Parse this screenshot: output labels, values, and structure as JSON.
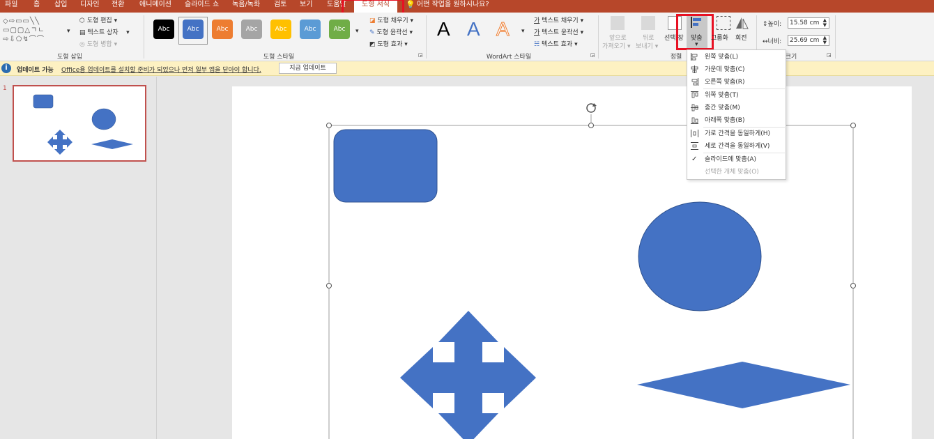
{
  "tabs": {
    "items": [
      "파일",
      "홈",
      "삽입",
      "디자인",
      "전환",
      "애니메이션",
      "슬라이드 쇼",
      "녹음/녹화",
      "검토",
      "보기",
      "도움말"
    ],
    "active": "도형 서식",
    "tell_me": "어떤 작업을 원하시나요?"
  },
  "ribbon": {
    "insert_shapes": {
      "label": "도형 삽입",
      "edit_shape": "도형 편집",
      "text_box": "텍스트 상자",
      "merge_shapes": "도형 병합"
    },
    "shape_styles": {
      "label": "도형 스타일",
      "swatch_text": "Abc",
      "swatch_colors": [
        "#000000",
        "#4472c4",
        "#ed7d31",
        "#a5a5a5",
        "#ffc000",
        "#5b9bd5",
        "#70ad47"
      ],
      "fill": "도형 채우기",
      "outline": "도형 윤곽선",
      "effects": "도형 효과"
    },
    "wordart": {
      "label": "WordArt 스타일",
      "text_fill": "텍스트 채우기",
      "text_outline": "텍스트 윤곽선",
      "text_effects": "텍스트 효과"
    },
    "arrange": {
      "label": "정렬",
      "bring_forward_1": "앞으로",
      "bring_forward_2": "가져오기",
      "send_backward_1": "뒤로",
      "send_backward_2": "보내기",
      "selection_pane": "선택 창",
      "align": "맞춤",
      "group": "그룹화",
      "rotate": "회전"
    },
    "size": {
      "label": "크기",
      "height_label": "높이:",
      "height_value": "15.58 cm",
      "width_label": "너비:",
      "width_value": "25.69 cm"
    }
  },
  "notice": {
    "title": "업데이트 가능",
    "message": "Office용 업데이트를 설치할 준비가 되었으나 먼저 일부 앱을 닫아야 합니다.",
    "button": "지금 업데이트"
  },
  "slides": {
    "number": "1"
  },
  "align_menu": {
    "items": [
      {
        "label": "왼쪽 맞춤(L)",
        "enabled": true
      },
      {
        "label": "가운데 맞춤(C)",
        "enabled": true
      },
      {
        "label": "오른쪽 맞춤(R)",
        "enabled": true
      },
      {
        "label": "위쪽 맞춤(T)",
        "enabled": true
      },
      {
        "label": "중간 맞춤(M)",
        "enabled": true
      },
      {
        "label": "아래쪽 맞춤(B)",
        "enabled": true
      },
      {
        "label": "가로 간격을 동일하게(H)",
        "enabled": true
      },
      {
        "label": "세로 간격을 동일하게(V)",
        "enabled": true
      },
      {
        "label": "슬라이드에 맞춤(A)",
        "enabled": true,
        "checked": true
      },
      {
        "label": "선택한 개체 맞춤(O)",
        "enabled": false
      }
    ]
  },
  "colors": {
    "accent": "#b7472a",
    "shape_fill": "#4472c4",
    "highlight": "#e81123"
  }
}
